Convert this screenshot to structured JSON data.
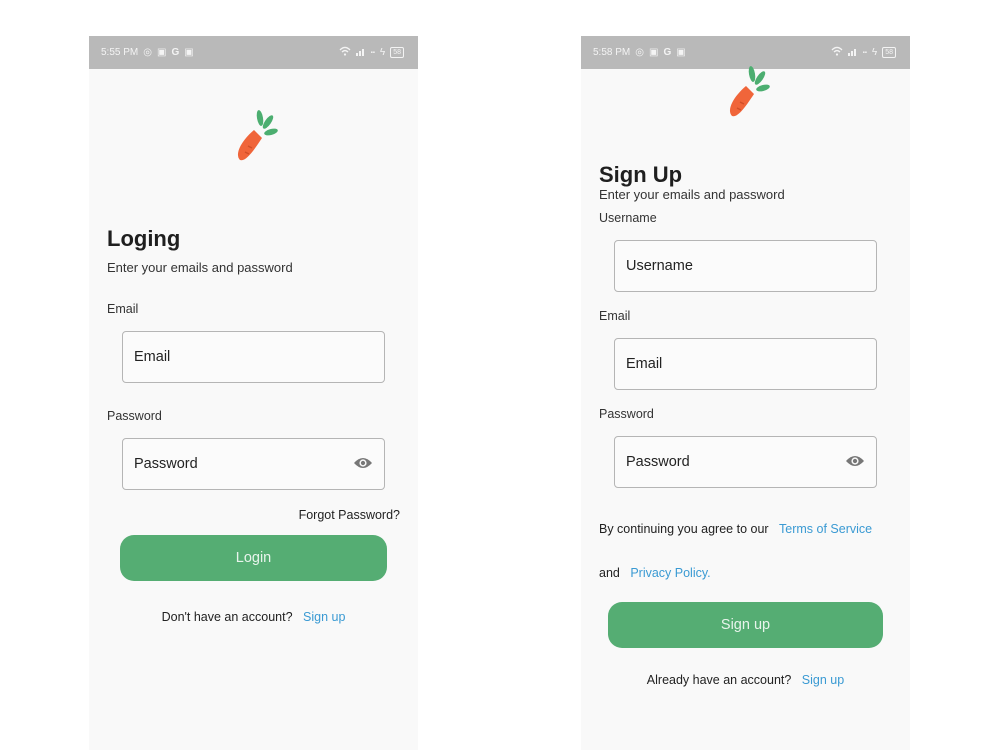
{
  "colors": {
    "accent_green": "#55ad73",
    "link_blue": "#3a9ad3",
    "carrot_orange": "#f0653a",
    "leaf_green": "#4cae70",
    "status_bar": "#b9b9b9"
  },
  "login_screen": {
    "status_time": "5:55 PM",
    "status_icons_left": [
      "whatsapp-icon",
      "notification-icon",
      "google-icon",
      "notification-icon"
    ],
    "status_icons_right": [
      "wifi-icon",
      "signal-icon",
      "network-speed-icon",
      "charging-icon"
    ],
    "battery": "58",
    "logo": "carrot-logo-icon",
    "title": "Loging",
    "subtitle": "Enter your emails and password",
    "email_label": "Email",
    "email_placeholder": "Email",
    "password_label": "Password",
    "password_placeholder": "Password",
    "forgot_password": "Forgot Password?",
    "login_button": "Login",
    "no_account_text": "Don't have an account?",
    "signup_link": "Sign up"
  },
  "signup_screen": {
    "status_time": "5:58 PM",
    "status_icons_left": [
      "whatsapp-icon",
      "notification-icon",
      "google-icon",
      "notification-icon"
    ],
    "status_icons_right": [
      "wifi-icon",
      "signal-icon",
      "network-speed-icon",
      "charging-icon"
    ],
    "battery": "58",
    "logo": "carrot-logo-icon",
    "title": "Sign Up",
    "subtitle": "Enter your emails and password",
    "username_label": "Username",
    "username_placeholder": "Username",
    "email_label": "Email",
    "email_placeholder": "Email",
    "password_label": "Password",
    "password_placeholder": "Password",
    "terms_text": "By continuing you agree to our",
    "terms_link": "Terms of Service",
    "and_text": "and",
    "privacy_link": "Privacy Policy.",
    "signup_button": "Sign up",
    "have_account_text": "Already have an account?",
    "signin_link": "Sign up"
  }
}
